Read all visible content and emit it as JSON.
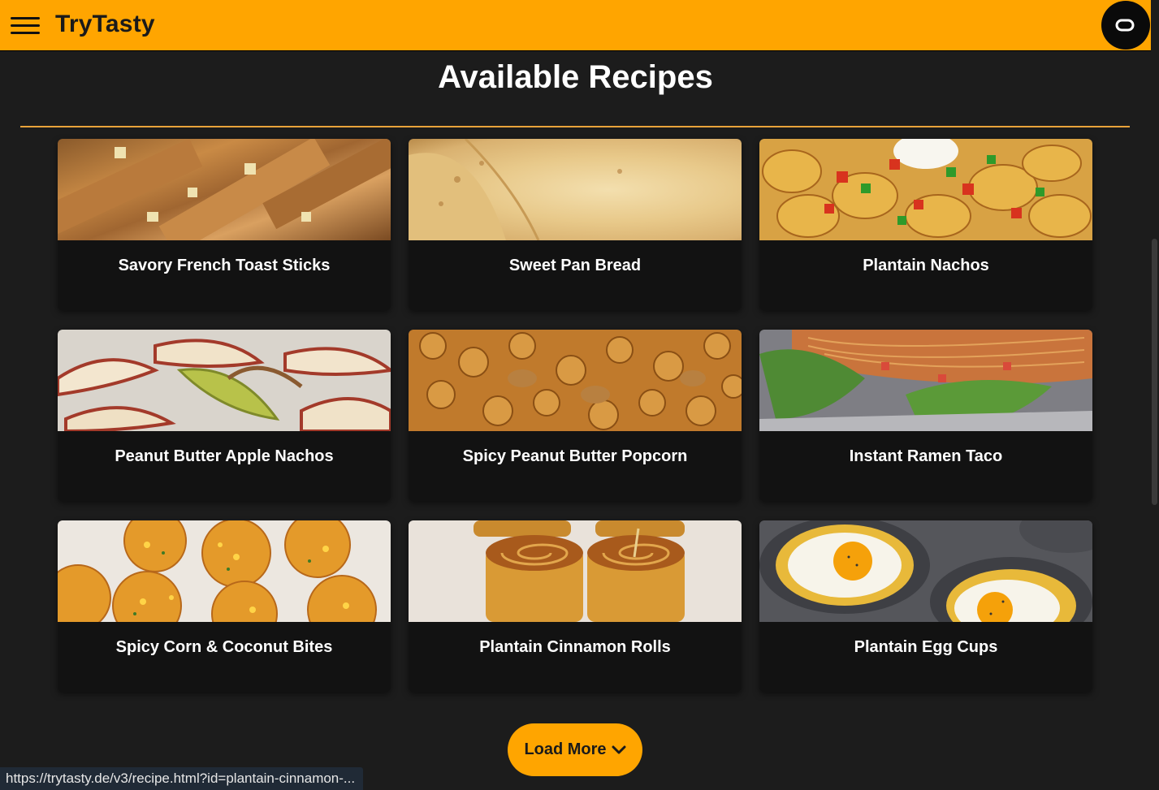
{
  "header": {
    "brand": "TryTasty",
    "menu_icon": "hamburger-menu-icon",
    "cc_icon": "closed-captions-icon"
  },
  "main": {
    "heading": "Available Recipes",
    "recipes": [
      {
        "title": "Savory French Toast Sticks",
        "image": "french-toast-sticks-image"
      },
      {
        "title": "Sweet Pan Bread",
        "image": "pan-bread-image"
      },
      {
        "title": "Plantain Nachos",
        "image": "plantain-nachos-image"
      },
      {
        "title": "Peanut Butter Apple Nachos",
        "image": "apple-nachos-image"
      },
      {
        "title": "Spicy Peanut Butter Popcorn",
        "image": "popcorn-image"
      },
      {
        "title": "Instant Ramen Taco",
        "image": "ramen-taco-image"
      },
      {
        "title": "Spicy Corn & Coconut Bites",
        "image": "corn-bites-image"
      },
      {
        "title": "Plantain Cinnamon Rolls",
        "image": "cinnamon-rolls-image"
      },
      {
        "title": "Plantain Egg Cups",
        "image": "egg-cups-image"
      }
    ],
    "load_more_label": "Load More",
    "load_more_icon": "chevron-down-icon"
  },
  "status_bar": {
    "url": "https://trytasty.de/v3/recipe.html?id=plantain-cinnamon-..."
  },
  "colors": {
    "accent": "#ffa500",
    "background": "#1c1c1c",
    "card": "#121212",
    "divider": "#e8a23a"
  }
}
